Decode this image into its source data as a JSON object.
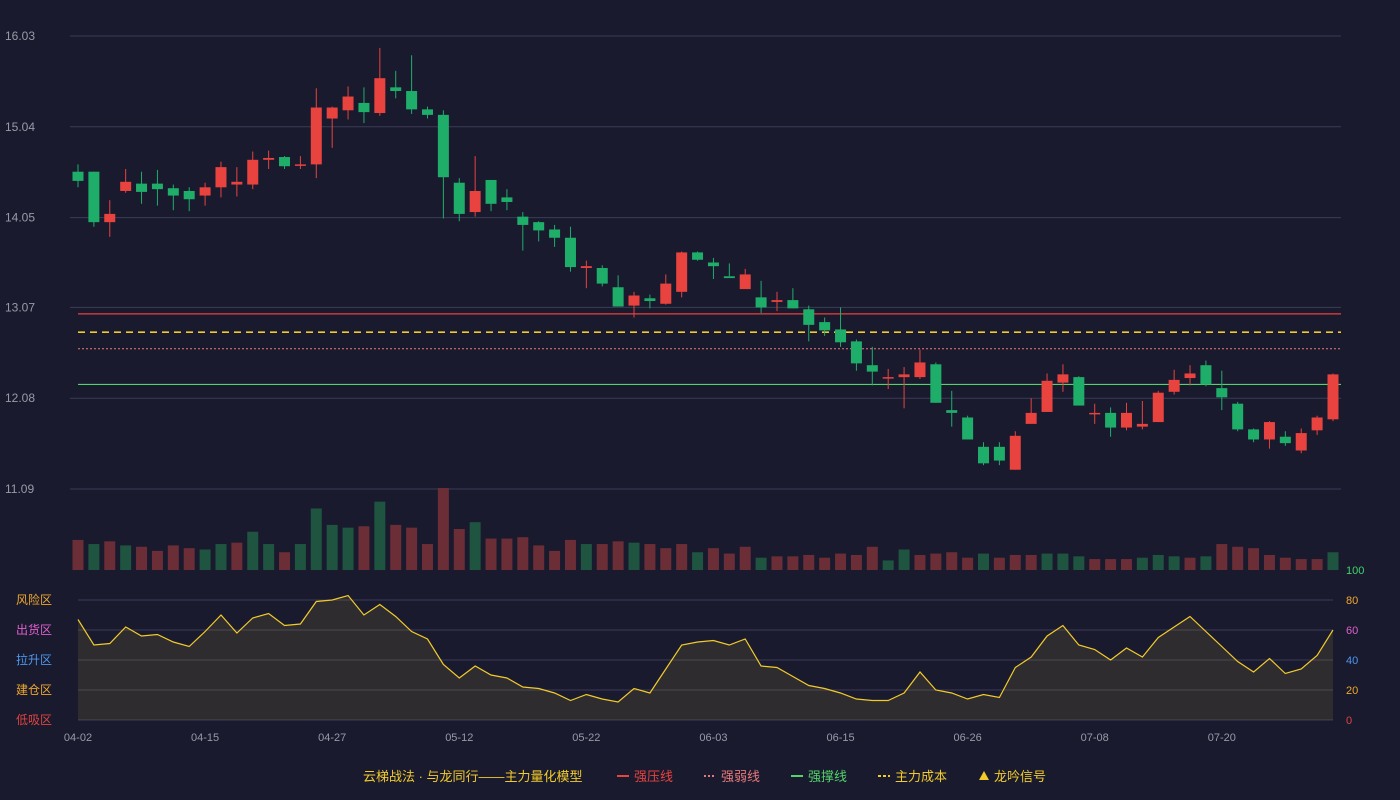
{
  "colors": {
    "background": "#191a2e",
    "up": "#e8433e",
    "down": "#1fae6a",
    "grid": "#3b3c55",
    "axis_text": "#9a9aa6",
    "indicator_line": "#f2cb2a",
    "pressure_line": "#e8433e",
    "weak_line": "#e8797a",
    "support_line": "#52d26a",
    "cost_line": "#f2cb2a"
  },
  "legend": {
    "title": "云梯战法 · 与龙同行——主力量化模型",
    "pressure": "强压线",
    "weak": "强弱线",
    "support": "强撑线",
    "cost": "主力成本",
    "signal": "龙吟信号"
  },
  "zones": [
    "风险区",
    "出货区",
    "拉升区",
    "建仓区",
    "低吸区"
  ],
  "chart_data": [
    {
      "type": "candlestick",
      "price_ticks": [
        16.03,
        15.04,
        14.05,
        13.07,
        12.08,
        11.09
      ],
      "ylim": [
        11.09,
        16.03
      ],
      "x_ticks": [
        "04-02",
        "04-15",
        "04-27",
        "05-12",
        "05-22",
        "06-03",
        "06-15",
        "06-26",
        "07-08",
        "07-20"
      ],
      "x_tick_index": [
        0,
        8,
        16,
        24,
        32,
        40,
        48,
        56,
        64,
        72
      ],
      "reference_lines": {
        "pressure": 13.0,
        "cost": 12.8,
        "weak": 12.62,
        "support": 12.23
      },
      "candles": [
        [
          14.55,
          14.45,
          14.63,
          14.38
        ],
        [
          14.55,
          14.0,
          14.55,
          13.95
        ],
        [
          14.0,
          14.09,
          14.24,
          13.84
        ],
        [
          14.34,
          14.44,
          14.58,
          14.32
        ],
        [
          14.42,
          14.33,
          14.55,
          14.2
        ],
        [
          14.42,
          14.36,
          14.57,
          14.18
        ],
        [
          14.37,
          14.29,
          14.41,
          14.13
        ],
        [
          14.34,
          14.25,
          14.38,
          14.12
        ],
        [
          14.29,
          14.38,
          14.43,
          14.18
        ],
        [
          14.38,
          14.6,
          14.66,
          14.27
        ],
        [
          14.41,
          14.44,
          14.6,
          14.28
        ],
        [
          14.41,
          14.68,
          14.77,
          14.36
        ],
        [
          14.68,
          14.7,
          14.78,
          14.58
        ],
        [
          14.71,
          14.61,
          14.72,
          14.58
        ],
        [
          14.62,
          14.63,
          14.72,
          14.58
        ],
        [
          14.63,
          15.25,
          15.46,
          14.48
        ],
        [
          15.13,
          15.25,
          15.26,
          14.81
        ],
        [
          15.22,
          15.37,
          15.48,
          15.12
        ],
        [
          15.3,
          15.2,
          15.47,
          15.08
        ],
        [
          15.19,
          15.57,
          15.9,
          15.16
        ],
        [
          15.47,
          15.43,
          15.65,
          15.35
        ],
        [
          15.43,
          15.23,
          15.82,
          15.18
        ],
        [
          15.23,
          15.17,
          15.26,
          15.13
        ],
        [
          15.17,
          14.49,
          15.22,
          14.04
        ],
        [
          14.43,
          14.09,
          14.48,
          14.01
        ],
        [
          14.11,
          14.34,
          14.72,
          14.06
        ],
        [
          14.46,
          14.2,
          14.46,
          14.12
        ],
        [
          14.27,
          14.22,
          14.36,
          14.13
        ],
        [
          14.06,
          13.97,
          14.11,
          13.69
        ],
        [
          14.0,
          13.91,
          14.01,
          13.79
        ],
        [
          13.92,
          13.83,
          13.97,
          13.73
        ],
        [
          13.83,
          13.51,
          13.95,
          13.46
        ],
        [
          13.5,
          13.52,
          13.58,
          13.28
        ],
        [
          13.5,
          13.33,
          13.53,
          13.3
        ],
        [
          13.29,
          13.08,
          13.42,
          13.08
        ],
        [
          13.09,
          13.2,
          13.24,
          12.96
        ],
        [
          13.17,
          13.14,
          13.21,
          13.06
        ],
        [
          13.11,
          13.33,
          13.43,
          13.1
        ],
        [
          13.24,
          13.67,
          13.68,
          13.18
        ],
        [
          13.67,
          13.59,
          13.68,
          13.58
        ],
        [
          13.56,
          13.52,
          13.61,
          13.38
        ],
        [
          13.41,
          13.39,
          13.55,
          13.41
        ],
        [
          13.27,
          13.43,
          13.49,
          13.43
        ],
        [
          13.18,
          13.07,
          13.36,
          13.01
        ],
        [
          13.13,
          13.15,
          13.24,
          13.03
        ],
        [
          13.15,
          13.06,
          13.28,
          13.06
        ],
        [
          13.05,
          12.88,
          13.09,
          12.7
        ],
        [
          12.91,
          12.82,
          12.96,
          12.76
        ],
        [
          12.83,
          12.69,
          13.07,
          12.64
        ],
        [
          12.7,
          12.46,
          12.72,
          12.38
        ],
        [
          12.44,
          12.37,
          12.64,
          12.22
        ],
        [
          12.3,
          12.31,
          12.4,
          12.18
        ],
        [
          12.31,
          12.34,
          12.42,
          11.97
        ],
        [
          12.31,
          12.47,
          12.61,
          12.29
        ],
        [
          12.45,
          12.03,
          12.47,
          12.03
        ],
        [
          11.95,
          11.92,
          12.16,
          11.77
        ],
        [
          11.87,
          11.63,
          11.89,
          11.63
        ],
        [
          11.55,
          11.37,
          11.6,
          11.35
        ],
        [
          11.55,
          11.4,
          11.6,
          11.35
        ],
        [
          11.3,
          11.67,
          11.72,
          11.3
        ],
        [
          11.8,
          11.92,
          12.08,
          11.82
        ],
        [
          11.93,
          12.27,
          12.35,
          11.93
        ],
        [
          12.25,
          12.34,
          12.45,
          12.15
        ],
        [
          12.31,
          12.0,
          12.32,
          12.0
        ],
        [
          11.91,
          11.92,
          12.02,
          11.8
        ],
        [
          11.92,
          11.76,
          11.98,
          11.66
        ],
        [
          11.76,
          11.92,
          12.03,
          11.73
        ],
        [
          11.77,
          11.8,
          12.05,
          11.74
        ],
        [
          11.82,
          12.14,
          12.16,
          11.82
        ],
        [
          12.15,
          12.28,
          12.39,
          12.12
        ],
        [
          12.3,
          12.35,
          12.44,
          12.22
        ],
        [
          12.44,
          12.23,
          12.49,
          12.21
        ],
        [
          12.19,
          12.09,
          12.38,
          11.95
        ],
        [
          12.02,
          11.74,
          12.04,
          11.72
        ],
        [
          11.74,
          11.63,
          11.75,
          11.6
        ],
        [
          11.63,
          11.82,
          11.83,
          11.53
        ],
        [
          11.66,
          11.59,
          11.72,
          11.56
        ],
        [
          11.51,
          11.7,
          11.75,
          11.48
        ],
        [
          11.73,
          11.87,
          11.89,
          11.68
        ],
        [
          11.85,
          12.34,
          12.35,
          11.83
        ]
      ],
      "volume": [
        110,
        95,
        105,
        90,
        85,
        70,
        90,
        80,
        75,
        95,
        100,
        140,
        95,
        65,
        95,
        225,
        165,
        155,
        160,
        250,
        165,
        155,
        95,
        300,
        150,
        175,
        115,
        115,
        120,
        90,
        70,
        110,
        95,
        95,
        105,
        100,
        95,
        80,
        95,
        65,
        80,
        60,
        85,
        45,
        50,
        50,
        55,
        45,
        60,
        55,
        85,
        35,
        75,
        55,
        60,
        65,
        45,
        60,
        45,
        55,
        55,
        60,
        60,
        50,
        40,
        40,
        40,
        45,
        55,
        50,
        45,
        50,
        95,
        85,
        80,
        55,
        45,
        40,
        40,
        65,
        105
      ],
      "volume_up": [
        1,
        0,
        1,
        0,
        1,
        1,
        1,
        1,
        0,
        0,
        1,
        0,
        0,
        1,
        0,
        0,
        0,
        0,
        1,
        0,
        1,
        1,
        1,
        1,
        1,
        0,
        1,
        1,
        1,
        1,
        1,
        1,
        0,
        1,
        1,
        0,
        1,
        1,
        1,
        0,
        1,
        1,
        1,
        0,
        1,
        1,
        1,
        1,
        1,
        1,
        1,
        0,
        0,
        1,
        1,
        1,
        1,
        0,
        1,
        1,
        1,
        0,
        0,
        0,
        1,
        1,
        1,
        0,
        0,
        0,
        1,
        0,
        1,
        1,
        1,
        1,
        1,
        1,
        1,
        0,
        0
      ]
    },
    {
      "type": "line",
      "series": [
        {
          "values": [
            67,
            50,
            51,
            62,
            56,
            57,
            52,
            49,
            59,
            70,
            58,
            68,
            71,
            63,
            64,
            79,
            80,
            83,
            70,
            77,
            69,
            59,
            54,
            37,
            28,
            36,
            30,
            28,
            22,
            21,
            18,
            13,
            17,
            14,
            12,
            21,
            18,
            34,
            50,
            52,
            53,
            50,
            54,
            36,
            35,
            29,
            23,
            21,
            18,
            14,
            13,
            13,
            18,
            32,
            20,
            18,
            14,
            17,
            15,
            35,
            42,
            56,
            63,
            50,
            47,
            40,
            48,
            42,
            55,
            62,
            69,
            59,
            49,
            39,
            32,
            41,
            31,
            34,
            43,
            60
          ]
        }
      ],
      "y_ticks": [
        100,
        80,
        60,
        40,
        20,
        0
      ],
      "ylim": [
        0,
        100
      ],
      "tick_colors": [
        "#3ed56b",
        "#f0a82c",
        "#e05fcf",
        "#4d97ee",
        "#f0a82c",
        "#e0443e"
      ]
    }
  ]
}
